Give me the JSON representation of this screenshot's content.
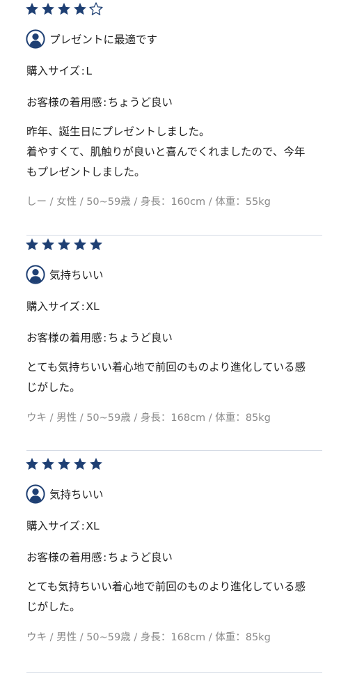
{
  "colors": {
    "star_fill": "#1e3f73",
    "avatar": "#1e3f73",
    "text": "#222222",
    "meta_text": "#8a8a8a",
    "divider": "#d5dbe5"
  },
  "icons": {
    "star_filled": "star-filled-icon",
    "star_empty": "star-outline-icon",
    "avatar": "user-avatar-icon"
  },
  "reviews": [
    {
      "rating": 4,
      "rating_max": 5,
      "title": "プレゼントに最適です",
      "size_label": "購入サイズ",
      "size_value": "L",
      "fit_label": "お客様の着用感",
      "fit_value": "ちょうど良い",
      "separator": ":",
      "body_lines": [
        "昨年、誕生日にプレゼントしました。",
        "着やすくて、肌触りが良いと喜んでくれましたので、今年",
        "もプレゼントしました。"
      ],
      "meta": "しー / 女性 / 50~59歳 / 身長：160cm / 体重：55kg"
    },
    {
      "rating": 5,
      "rating_max": 5,
      "title": "気持ちいい",
      "size_label": "購入サイズ",
      "size_value": "XL",
      "fit_label": "お客様の着用感",
      "fit_value": "ちょうど良い",
      "separator": ":",
      "body_lines": [
        "とても気持ちいい着心地で前回のものより進化している感",
        "じがした。"
      ],
      "meta": "ウキ / 男性 / 50~59歳 / 身長：168cm / 体重：85kg"
    },
    {
      "rating": 5,
      "rating_max": 5,
      "title": "気持ちいい",
      "size_label": "購入サイズ",
      "size_value": "XL",
      "fit_label": "お客様の着用感",
      "fit_value": "ちょうど良い",
      "separator": ":",
      "body_lines": [
        "とても気持ちいい着心地で前回のものより進化している感",
        "じがした。"
      ],
      "meta": "ウキ / 男性 / 50~59歳 / 身長：168cm / 体重：85kg"
    }
  ]
}
